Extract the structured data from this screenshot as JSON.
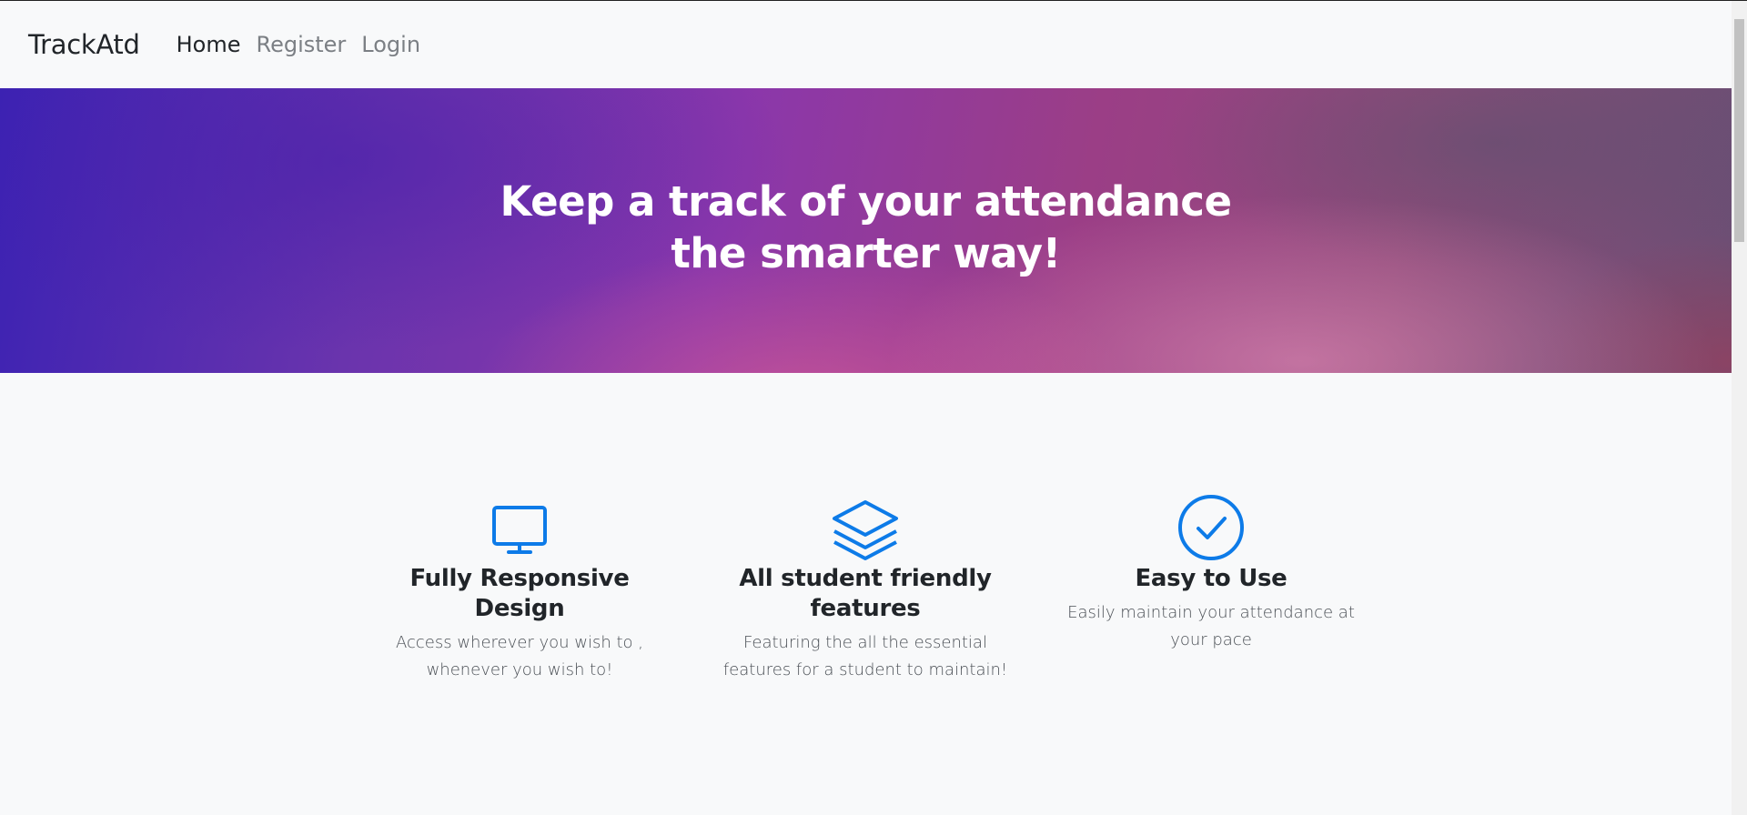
{
  "navbar": {
    "brand": "TrackAtd",
    "links": [
      {
        "label": "Home",
        "active": true
      },
      {
        "label": "Register",
        "active": false
      },
      {
        "label": "Login",
        "active": false
      }
    ]
  },
  "hero": {
    "title": "Keep a track of your attendance the smarter way!"
  },
  "features": [
    {
      "icon": "monitor-icon",
      "title": "Fully Responsive Design",
      "text": "Access wherever you wish to , whenever you wish to!"
    },
    {
      "icon": "layers-icon",
      "title": "All student friendly features",
      "text": "Featuring the all the essential features for a student to maintain!"
    },
    {
      "icon": "check-circle-icon",
      "title": "Easy to Use",
      "text": "Easily maintain your attendance at your pace"
    }
  ],
  "colors": {
    "accent": "#0d7be8",
    "text": "#212529",
    "muted_link": "#7b7f84"
  }
}
